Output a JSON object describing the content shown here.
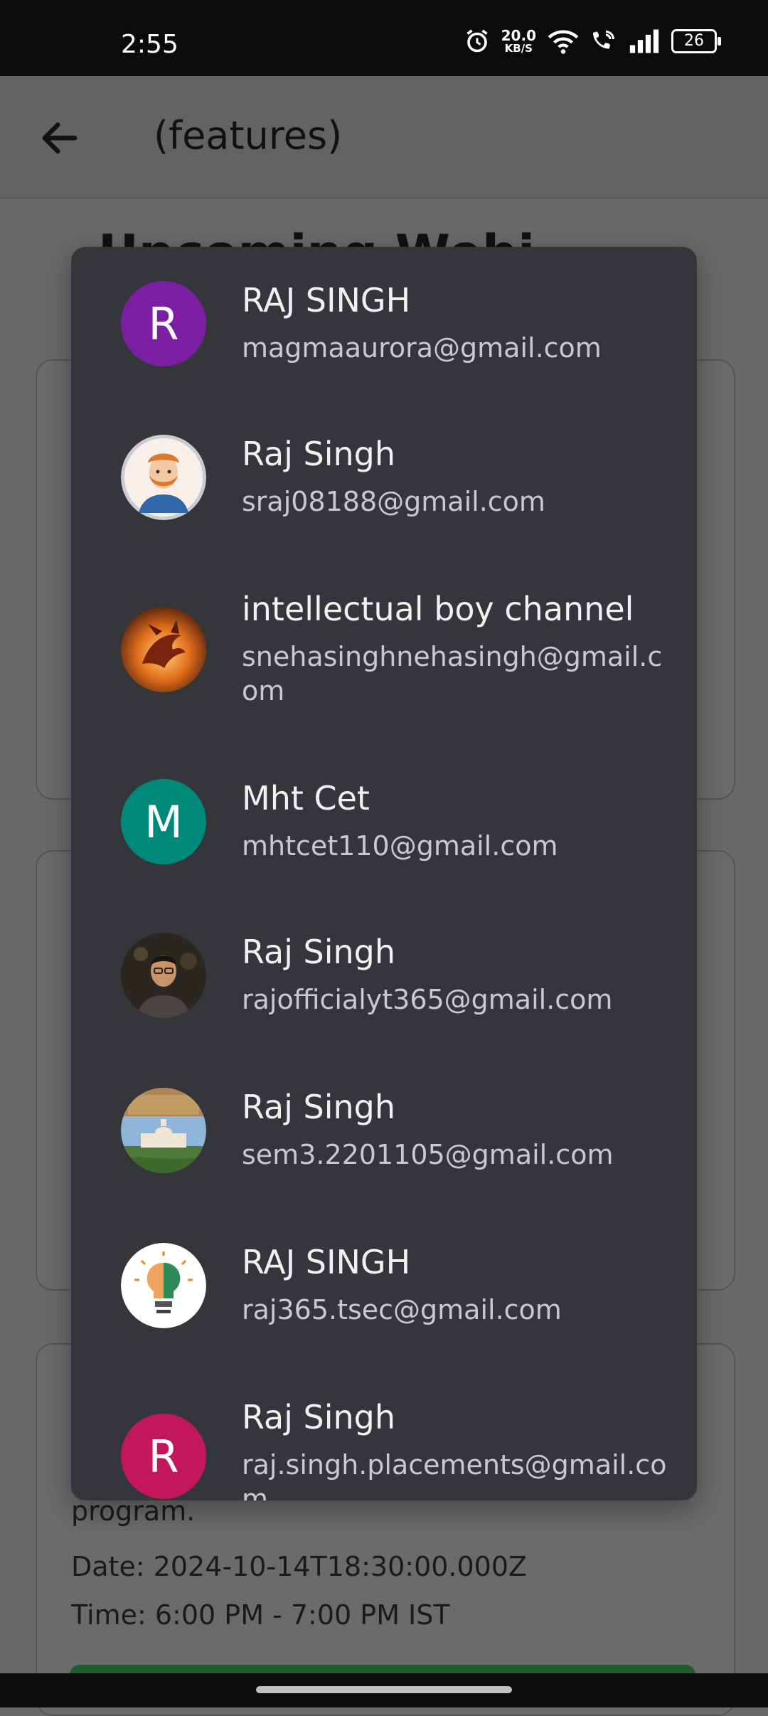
{
  "status_bar": {
    "time": "2:55",
    "speed_value": "20.0",
    "speed_unit": "KB/S",
    "battery": "26"
  },
  "app_bar": {
    "title": "(features)"
  },
  "background": {
    "heading_partial": "Upcoming Webi",
    "card_text": "program.",
    "date": "Date: 2024-10-14T18:30:00.000Z",
    "time": "Time: 6:00 PM - 7:00 PM IST"
  },
  "accounts": [
    {
      "name": "RAJ SINGH",
      "email": "magmaaurora@gmail.com",
      "avatar_type": "letter",
      "avatar_letter": "R",
      "avatar_color": "#7b1fa2"
    },
    {
      "name": "Raj Singh",
      "email": "sraj08188@gmail.com",
      "avatar_type": "cartoon-man-icon"
    },
    {
      "name": "intellectual boy channel",
      "email": "snehasinghnehasingh@gmail.com",
      "avatar_type": "dragon-icon"
    },
    {
      "name": "Mht Cet",
      "email": "mhtcet110@gmail.com",
      "avatar_type": "letter",
      "avatar_letter": "M",
      "avatar_color": "#00897b"
    },
    {
      "name": "Raj Singh",
      "email": "rajofficialyt365@gmail.com",
      "avatar_type": "person-photo-icon"
    },
    {
      "name": "Raj Singh",
      "email": "sem3.2201105@gmail.com",
      "avatar_type": "landmark-icon"
    },
    {
      "name": "RAJ SINGH",
      "email": "raj365.tsec@gmail.com",
      "avatar_type": "sih-logo-icon"
    },
    {
      "name": "Raj Singh",
      "email": "raj.singh.placements@gmail.com",
      "avatar_type": "letter",
      "avatar_letter": "R",
      "avatar_color": "#c2185b"
    }
  ]
}
